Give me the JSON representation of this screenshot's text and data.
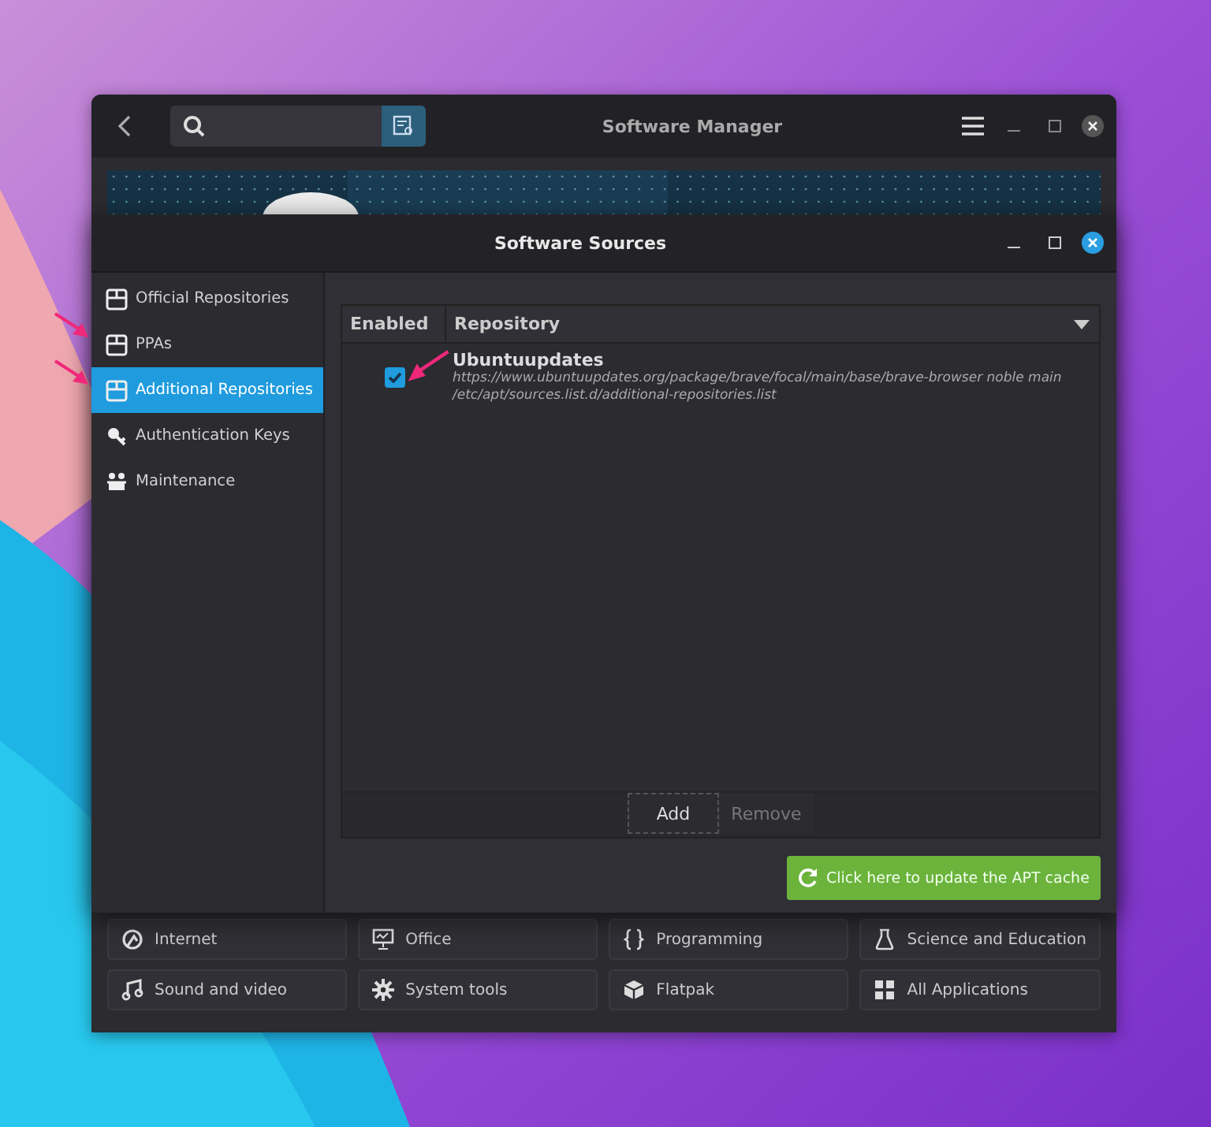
{
  "main_window": {
    "title": "Software Manager",
    "categories": [
      {
        "label": "Internet"
      },
      {
        "label": "Office"
      },
      {
        "label": "Programming"
      },
      {
        "label": "Science and Education"
      },
      {
        "label": "Sound and video"
      },
      {
        "label": "System tools"
      },
      {
        "label": "Flatpak"
      },
      {
        "label": "All Applications"
      }
    ]
  },
  "dialog": {
    "title": "Software Sources",
    "sidebar": {
      "items": [
        {
          "label": "Official Repositories",
          "selected": false
        },
        {
          "label": "PPAs",
          "selected": false
        },
        {
          "label": "Additional Repositories",
          "selected": true
        },
        {
          "label": "Authentication Keys",
          "selected": false
        },
        {
          "label": "Maintenance",
          "selected": false
        }
      ]
    },
    "table": {
      "columns": [
        "Enabled",
        "Repository"
      ],
      "rows": [
        {
          "checked": true,
          "name": "Ubuntuupdates",
          "line": "https://www.ubuntuupdates.org/package/brave/focal/main/base/brave-browser noble main",
          "file": "/etc/apt/sources.list.d/additional-repositories.list"
        }
      ]
    },
    "buttons": [
      {
        "label": "Add",
        "disabled": false
      },
      {
        "label": "Remove",
        "disabled": true
      }
    ],
    "update_button": "Click here to update the APT cache"
  }
}
